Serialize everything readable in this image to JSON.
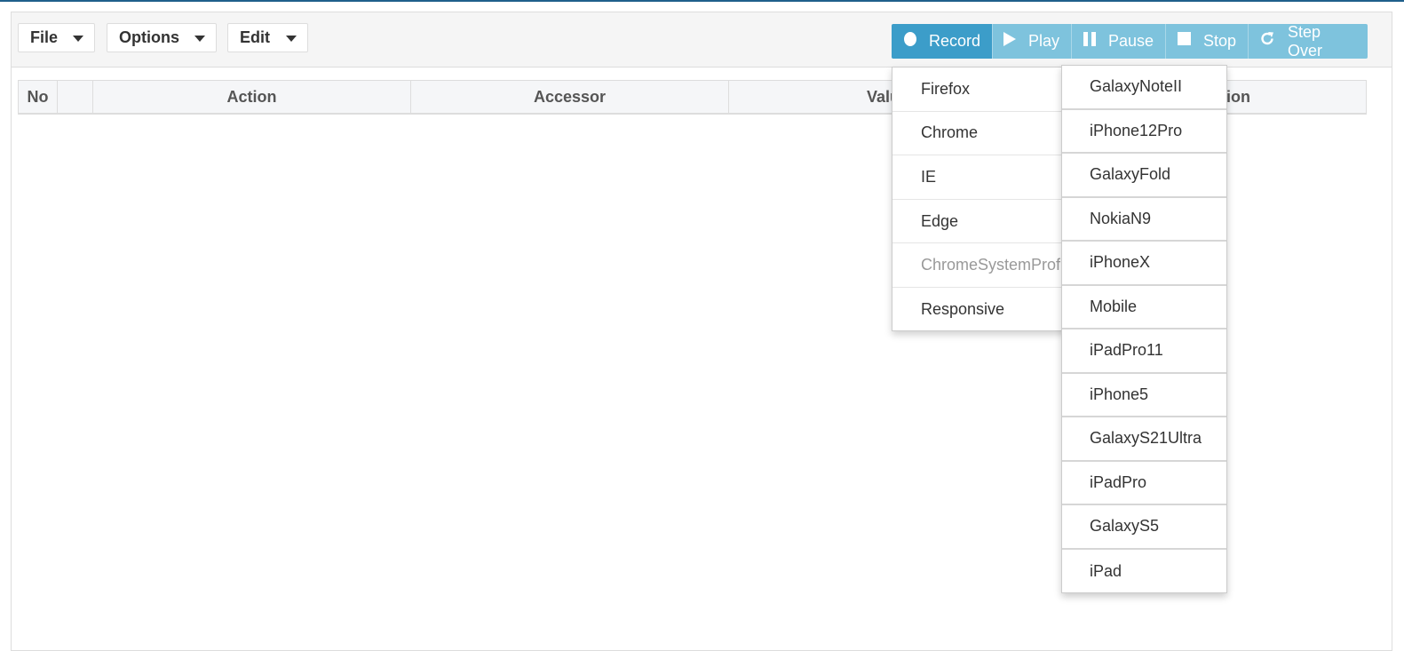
{
  "menus": {
    "file": "File",
    "options": "Options",
    "edit": "Edit"
  },
  "controls": {
    "record": "Record",
    "play": "Play",
    "pause": "Pause",
    "stop": "Stop",
    "step_over": "Step Over"
  },
  "table": {
    "headers": [
      "No",
      "",
      "Action",
      "Accessor",
      "Value",
      "Description"
    ]
  },
  "browser_menu": {
    "items": [
      "Firefox",
      "Chrome",
      "IE",
      "Edge",
      "ChromeSystemProfile",
      "Responsive"
    ],
    "disabled_item": "ChromeSystemProfile"
  },
  "device_menu": {
    "items": [
      "GalaxyNoteII",
      "iPhone12Pro",
      "GalaxyFold",
      "NokiaN9",
      "iPhoneX",
      "Mobile",
      "iPadPro11",
      "iPhone5",
      "GalaxyS21Ultra",
      "iPadPro",
      "GalaxyS5",
      "iPad"
    ]
  },
  "colors": {
    "record_active": "#3c9dc9",
    "controls_disabled": "#7ec3dd",
    "top_border": "#1f5f8b"
  }
}
